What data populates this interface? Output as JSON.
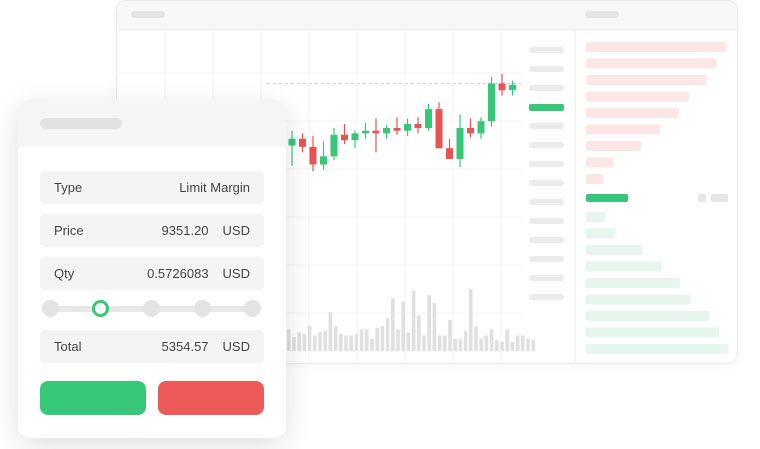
{
  "order_form": {
    "fields": [
      {
        "label": "Type",
        "value": "Limit Margin",
        "unit": ""
      },
      {
        "label": "Price",
        "value": "9351.20",
        "unit": "USD"
      },
      {
        "label": "Qty",
        "value": "0.5726083",
        "unit": "USD"
      },
      {
        "label": "Total",
        "value": "5354.57",
        "unit": "USD"
      }
    ],
    "slider": {
      "steps": 5,
      "active_step": 1
    },
    "buttons": {
      "buy_label": "",
      "sell_label": ""
    }
  },
  "colors": {
    "up": "#37c778",
    "down": "#e85454",
    "volume": "#e0e0e0",
    "ask_bar": "#fde6e6",
    "bid_bar": "#e6f6ec"
  },
  "chart_data": {
    "type": "candlestick",
    "candles": [
      {
        "o": 47,
        "h": 58,
        "l": 32,
        "c": 52
      },
      {
        "o": 52,
        "h": 56,
        "l": 42,
        "c": 46
      },
      {
        "o": 46,
        "h": 54,
        "l": 28,
        "c": 33
      },
      {
        "o": 33,
        "h": 50,
        "l": 29,
        "c": 39
      },
      {
        "o": 39,
        "h": 60,
        "l": 36,
        "c": 55
      },
      {
        "o": 55,
        "h": 63,
        "l": 48,
        "c": 51
      },
      {
        "o": 51,
        "h": 58,
        "l": 45,
        "c": 56
      },
      {
        "o": 56,
        "h": 64,
        "l": 52,
        "c": 58
      },
      {
        "o": 58,
        "h": 67,
        "l": 42,
        "c": 56
      },
      {
        "o": 56,
        "h": 62,
        "l": 52,
        "c": 60
      },
      {
        "o": 60,
        "h": 68,
        "l": 55,
        "c": 58
      },
      {
        "o": 58,
        "h": 67,
        "l": 54,
        "c": 63
      },
      {
        "o": 63,
        "h": 68,
        "l": 56,
        "c": 60
      },
      {
        "o": 60,
        "h": 78,
        "l": 58,
        "c": 74
      },
      {
        "o": 74,
        "h": 79,
        "l": 55,
        "c": 45
      },
      {
        "o": 45,
        "h": 52,
        "l": 39,
        "c": 37
      },
      {
        "o": 37,
        "h": 70,
        "l": 31,
        "c": 60
      },
      {
        "o": 60,
        "h": 67,
        "l": 53,
        "c": 56
      },
      {
        "o": 56,
        "h": 68,
        "l": 52,
        "c": 65
      },
      {
        "o": 65,
        "h": 98,
        "l": 61,
        "c": 93
      },
      {
        "o": 93,
        "h": 100,
        "l": 84,
        "c": 88
      },
      {
        "o": 88,
        "h": 95,
        "l": 84,
        "c": 92
      }
    ],
    "volumes": [
      14,
      9,
      12,
      11,
      16,
      10,
      12,
      13,
      25,
      16,
      11,
      10,
      10,
      11,
      14,
      14,
      8,
      15,
      16,
      21,
      34,
      14,
      32,
      12,
      39,
      23,
      10,
      36,
      31,
      10,
      10,
      20,
      8,
      8,
      13,
      40,
      16,
      8,
      10,
      14,
      7,
      6,
      14,
      6,
      10,
      10,
      8,
      7
    ],
    "ylim": [
      0,
      100
    ],
    "current_price_level": 93
  },
  "order_book": {
    "asks": [
      0.97,
      0.9,
      0.83,
      0.71,
      0.64,
      0.51,
      0.38,
      0.19,
      0.12
    ],
    "bids": [
      0.13,
      0.2,
      0.39,
      0.52,
      0.65,
      0.72,
      0.85,
      0.92,
      0.98
    ],
    "spread_level": 0.29
  }
}
